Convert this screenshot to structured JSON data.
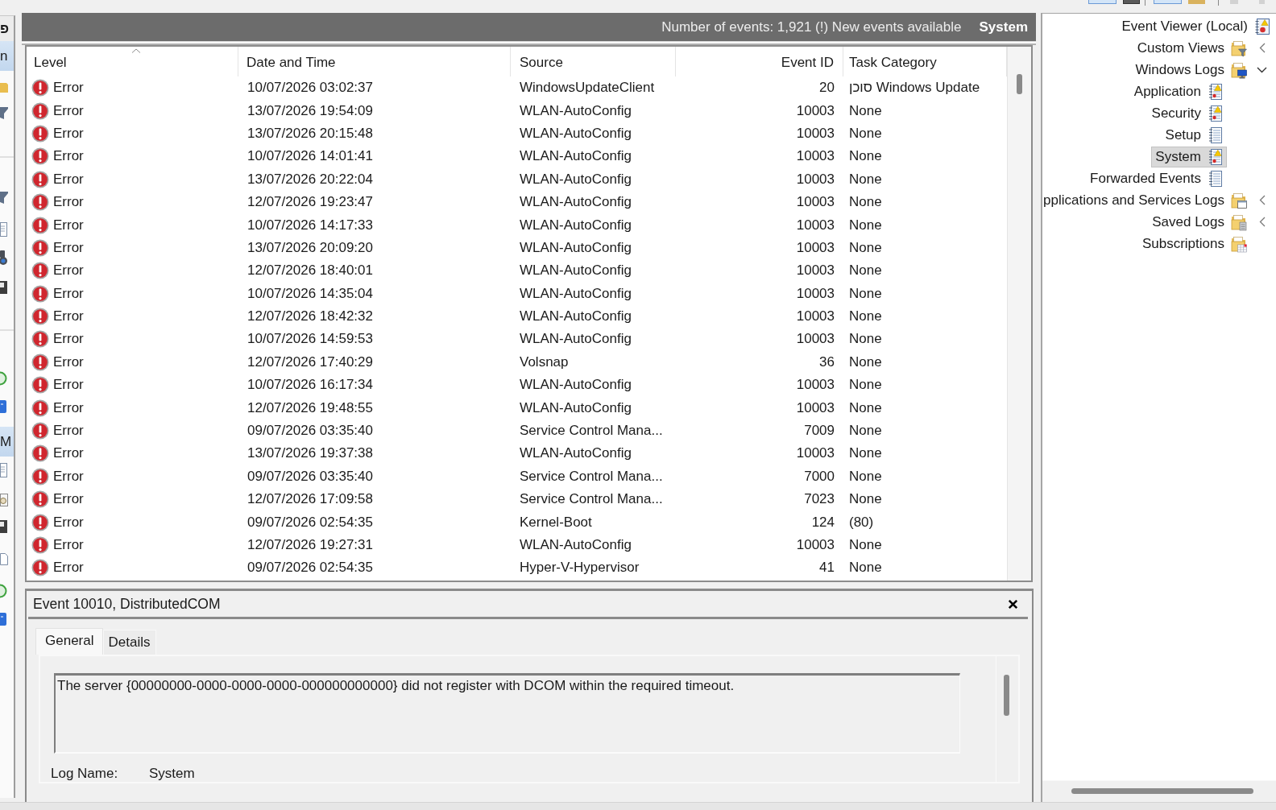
{
  "action_pane": {
    "title": "פ",
    "sections": [
      {
        "title": "n"
      },
      {
        "title": "M"
      }
    ]
  },
  "events": {
    "summary": "Number of events: 1,921 (!) New events available",
    "log_name": "System",
    "columns": [
      "Level",
      "Date and Time",
      "Source",
      "Event ID",
      "Task Category"
    ],
    "rows": [
      {
        "level": "Error",
        "date_time": "10/07/2026 03:02:37",
        "source": "WindowsUpdateClient",
        "event_id": "20",
        "task_category": "סוכן Windows Update"
      },
      {
        "level": "Error",
        "date_time": "13/07/2026 19:54:09",
        "source": "WLAN-AutoConfig",
        "event_id": "10003",
        "task_category": "None"
      },
      {
        "level": "Error",
        "date_time": "13/07/2026 20:15:48",
        "source": "WLAN-AutoConfig",
        "event_id": "10003",
        "task_category": "None"
      },
      {
        "level": "Error",
        "date_time": "10/07/2026 14:01:41",
        "source": "WLAN-AutoConfig",
        "event_id": "10003",
        "task_category": "None"
      },
      {
        "level": "Error",
        "date_time": "13/07/2026 20:22:04",
        "source": "WLAN-AutoConfig",
        "event_id": "10003",
        "task_category": "None"
      },
      {
        "level": "Error",
        "date_time": "12/07/2026 19:23:47",
        "source": "WLAN-AutoConfig",
        "event_id": "10003",
        "task_category": "None"
      },
      {
        "level": "Error",
        "date_time": "10/07/2026 14:17:33",
        "source": "WLAN-AutoConfig",
        "event_id": "10003",
        "task_category": "None"
      },
      {
        "level": "Error",
        "date_time": "13/07/2026 20:09:20",
        "source": "WLAN-AutoConfig",
        "event_id": "10003",
        "task_category": "None"
      },
      {
        "level": "Error",
        "date_time": "12/07/2026 18:40:01",
        "source": "WLAN-AutoConfig",
        "event_id": "10003",
        "task_category": "None"
      },
      {
        "level": "Error",
        "date_time": "10/07/2026 14:35:04",
        "source": "WLAN-AutoConfig",
        "event_id": "10003",
        "task_category": "None"
      },
      {
        "level": "Error",
        "date_time": "12/07/2026 18:42:32",
        "source": "WLAN-AutoConfig",
        "event_id": "10003",
        "task_category": "None"
      },
      {
        "level": "Error",
        "date_time": "10/07/2026 14:59:53",
        "source": "WLAN-AutoConfig",
        "event_id": "10003",
        "task_category": "None"
      },
      {
        "level": "Error",
        "date_time": "12/07/2026 17:40:29",
        "source": "Volsnap",
        "event_id": "36",
        "task_category": "None"
      },
      {
        "level": "Error",
        "date_time": "10/07/2026 16:17:34",
        "source": "WLAN-AutoConfig",
        "event_id": "10003",
        "task_category": "None"
      },
      {
        "level": "Error",
        "date_time": "12/07/2026 19:48:55",
        "source": "WLAN-AutoConfig",
        "event_id": "10003",
        "task_category": "None"
      },
      {
        "level": "Error",
        "date_time": "09/07/2026 03:35:40",
        "source": "Service Control Mana...",
        "event_id": "7009",
        "task_category": "None"
      },
      {
        "level": "Error",
        "date_time": "13/07/2026 19:37:38",
        "source": "WLAN-AutoConfig",
        "event_id": "10003",
        "task_category": "None"
      },
      {
        "level": "Error",
        "date_time": "09/07/2026 03:35:40",
        "source": "Service Control Mana...",
        "event_id": "7000",
        "task_category": "None"
      },
      {
        "level": "Error",
        "date_time": "12/07/2026 17:09:58",
        "source": "Service Control Mana...",
        "event_id": "7023",
        "task_category": "None"
      },
      {
        "level": "Error",
        "date_time": "09/07/2026 02:54:35",
        "source": "Kernel-Boot",
        "event_id": "124",
        "task_category": "(80)"
      },
      {
        "level": "Error",
        "date_time": "12/07/2026 19:27:31",
        "source": "WLAN-AutoConfig",
        "event_id": "10003",
        "task_category": "None"
      },
      {
        "level": "Error",
        "date_time": "09/07/2026 02:54:35",
        "source": "Hyper-V-Hypervisor",
        "event_id": "41",
        "task_category": "None"
      }
    ]
  },
  "event_details": {
    "title": "Event 10010, DistributedCOM",
    "tabs": [
      {
        "label": "General",
        "selected": true
      },
      {
        "label": "Details",
        "selected": false
      }
    ],
    "message": "The server {00000000-0000-0000-0000-000000000000} did not register with DCOM within the required timeout.",
    "fields": [
      {
        "label": "Log Name:",
        "value": "System"
      }
    ]
  },
  "tree": {
    "items": [
      {
        "label": "Event Viewer (Local)",
        "kind": "viewer",
        "selected": false,
        "children": [
          {
            "label": "Custom Views",
            "kind": "filter-folder",
            "selected": false,
            "expanded": false
          },
          {
            "label": "Windows Logs",
            "kind": "monitor-folder",
            "selected": false,
            "expanded": true,
            "children": [
              {
                "label": "Application",
                "kind": "alert-log",
                "selected": false
              },
              {
                "label": "Security",
                "kind": "alert-log",
                "selected": false
              },
              {
                "label": "Setup",
                "kind": "log",
                "selected": false
              },
              {
                "label": "System",
                "kind": "alert-log",
                "selected": true
              },
              {
                "label": "Forwarded Events",
                "kind": "log",
                "selected": false
              }
            ]
          },
          {
            "label": "pplications and Services Logs",
            "kind": "window-folder",
            "selected": false,
            "expanded": false
          },
          {
            "label": "Saved Logs",
            "kind": "saved-folder",
            "selected": false,
            "expanded": false
          },
          {
            "label": "Subscriptions",
            "kind": "subscription-folder",
            "selected": false
          }
        ]
      }
    ]
  }
}
